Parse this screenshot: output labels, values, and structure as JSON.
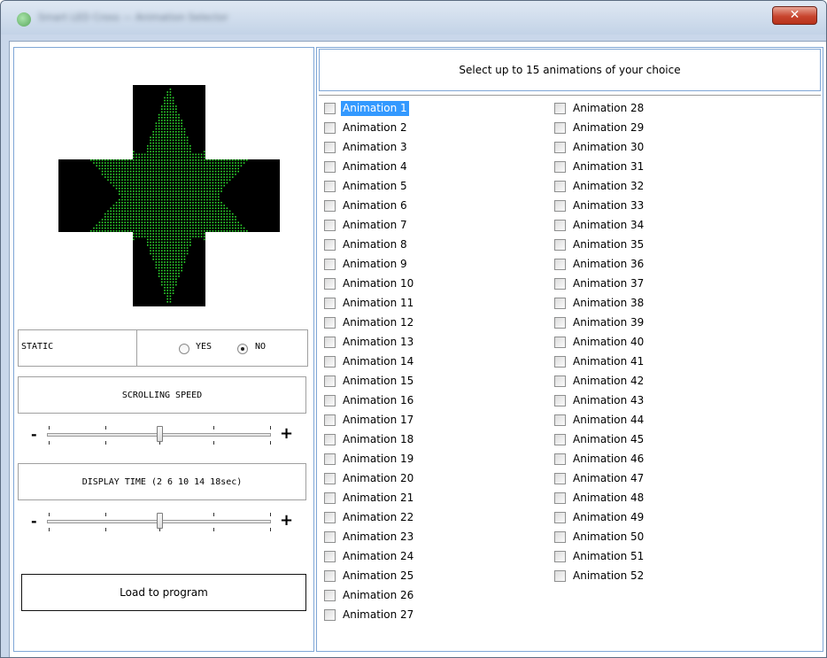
{
  "window": {
    "title": "Smart LED Cross — Animation Selector",
    "close_glyph": "✕"
  },
  "display": {
    "background_color": "#000000",
    "led_color": "#2edc2e"
  },
  "static": {
    "label": "STATIC",
    "yes_label": "YES",
    "no_label": "NO",
    "selected": "NO"
  },
  "scrolling_speed": {
    "label": "SCROLLING SPEED",
    "minus": "-",
    "plus": "+",
    "level": 0.5
  },
  "display_time": {
    "label": "DISPLAY TIME (2 6 10 14 18sec)",
    "minus": "-",
    "plus": "+",
    "level": 0.5
  },
  "load_button": {
    "label": "Load to program"
  },
  "animations": {
    "header": "Select up to 15 animations of your choice",
    "focused_index": 0,
    "items": [
      "Animation 1",
      "Animation 2",
      "Animation 3",
      "Animation 4",
      "Animation 5",
      "Animation 6",
      "Animation 7",
      "Animation 8",
      "Animation 9",
      "Animation 10",
      "Animation 11",
      "Animation 12",
      "Animation 13",
      "Animation 14",
      "Animation 15",
      "Animation 16",
      "Animation 17",
      "Animation 18",
      "Animation 19",
      "Animation 20",
      "Animation 21",
      "Animation 22",
      "Animation 23",
      "Animation 24",
      "Animation 25",
      "Animation 26",
      "Animation 27",
      "Animation 28",
      "Animation 29",
      "Animation 30",
      "Animation 31",
      "Animation 32",
      "Animation 33",
      "Animation 34",
      "Animation 35",
      "Animation 36",
      "Animation 37",
      "Animation 38",
      "Animation 39",
      "Animation 40",
      "Animation 41",
      "Animation 42",
      "Animation 43",
      "Animation 44",
      "Animation 45",
      "Animation 46",
      "Animation 47",
      "Animation 48",
      "Animation 49",
      "Animation 50",
      "Animation 51",
      "Animation 52"
    ]
  }
}
